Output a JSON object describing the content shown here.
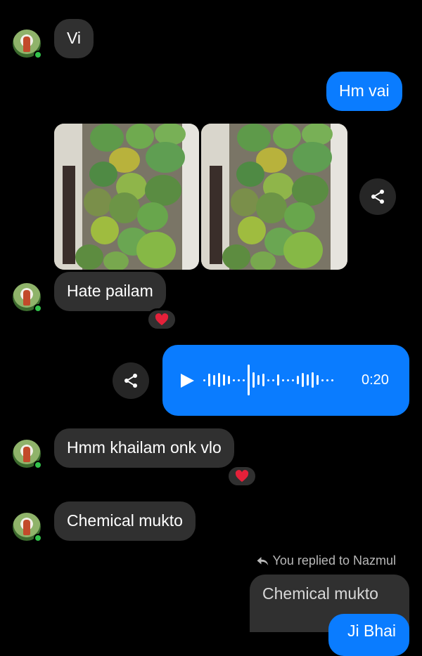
{
  "messages": [
    {
      "id": "m1",
      "direction": "in",
      "text": "Vi"
    },
    {
      "id": "m2",
      "direction": "out",
      "text": "Hm vai"
    },
    {
      "id": "m3",
      "direction": "in",
      "type": "photos",
      "count": 2,
      "subject": "green mangoes"
    },
    {
      "id": "m4",
      "direction": "in",
      "text": "Hate pailam",
      "reaction": "red-heart"
    },
    {
      "id": "m5",
      "direction": "out",
      "type": "voice",
      "duration": "0:20"
    },
    {
      "id": "m6",
      "direction": "in",
      "text": "Hmm khailam onk vlo",
      "reaction": "red-heart"
    },
    {
      "id": "m7",
      "direction": "in",
      "text": "Chemical mukto"
    }
  ],
  "reply": {
    "label": "You replied to Nazmul",
    "quoted_text": "Chemical mukto",
    "partial_text": "Ji Bhai"
  },
  "colors": {
    "background": "#000000",
    "incoming_bubble": "#303030",
    "outgoing_bubble": "#0a7cff",
    "online_dot": "#31c24a",
    "heart": "#e5213a"
  },
  "icons": [
    "share-icon",
    "play-icon",
    "reply-arrow-icon",
    "heart-icon",
    "online-indicator"
  ]
}
